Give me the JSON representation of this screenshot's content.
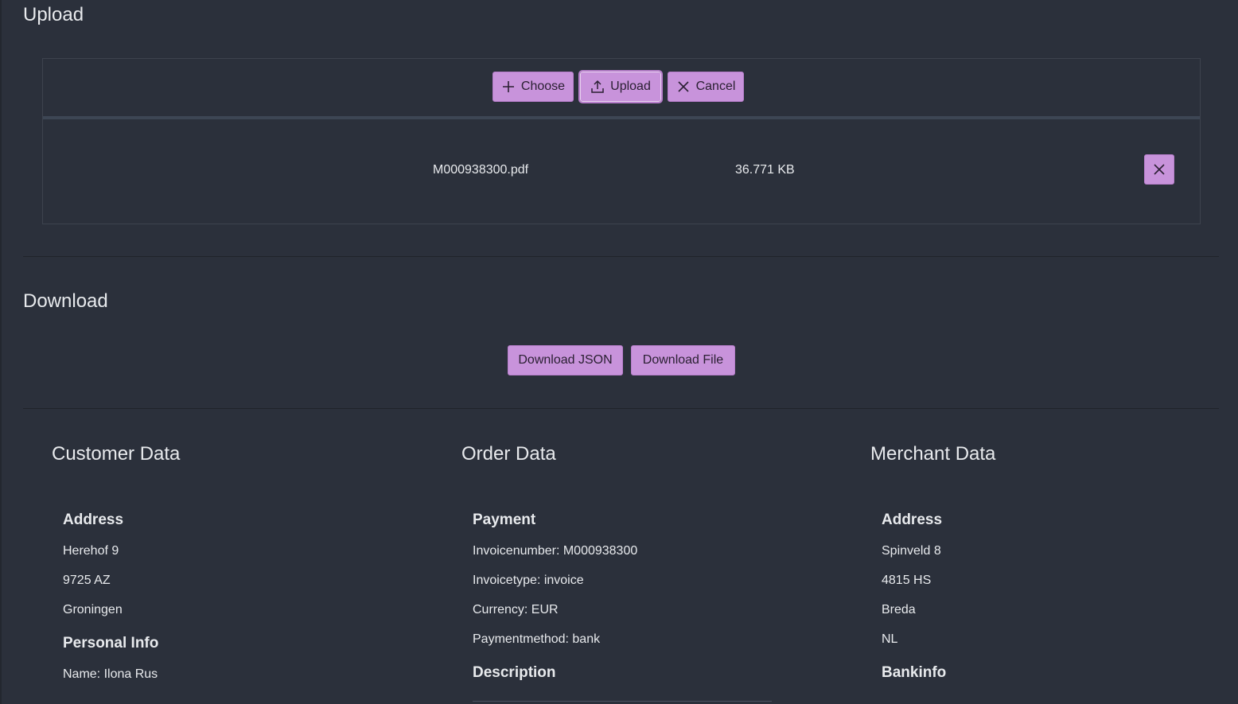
{
  "upload": {
    "title": "Upload",
    "buttons": {
      "choose": "Choose",
      "upload": "Upload",
      "cancel": "Cancel"
    },
    "file": {
      "name": "M000938300.pdf",
      "size": "36.771 KB"
    }
  },
  "download": {
    "title": "Download",
    "buttons": {
      "json": "Download JSON",
      "file": "Download File"
    }
  },
  "customer": {
    "title": "Customer Data",
    "address_heading": "Address",
    "address": [
      "Herehof 9",
      "9725 AZ",
      "Groningen"
    ],
    "personal_heading": "Personal Info",
    "personal": [
      "Name: Ilona Rus"
    ]
  },
  "order": {
    "title": "Order Data",
    "payment_heading": "Payment",
    "payment": [
      "Invoicenumber: M000938300",
      "Invoicetype: invoice",
      "Currency: EUR",
      "Paymentmethod: bank"
    ],
    "description_heading": "Description"
  },
  "merchant": {
    "title": "Merchant Data",
    "address_heading": "Address",
    "address": [
      "Spinveld 8",
      "4815 HS",
      "Breda",
      "NL"
    ],
    "bank_heading": "Bankinfo"
  },
  "colors": {
    "background": "#2b303b",
    "accent": "#c893db",
    "text": "#e8eaed"
  },
  "icons": {
    "choose": "plus-icon",
    "upload": "upload-icon",
    "cancel": "close-icon",
    "remove": "close-icon"
  }
}
